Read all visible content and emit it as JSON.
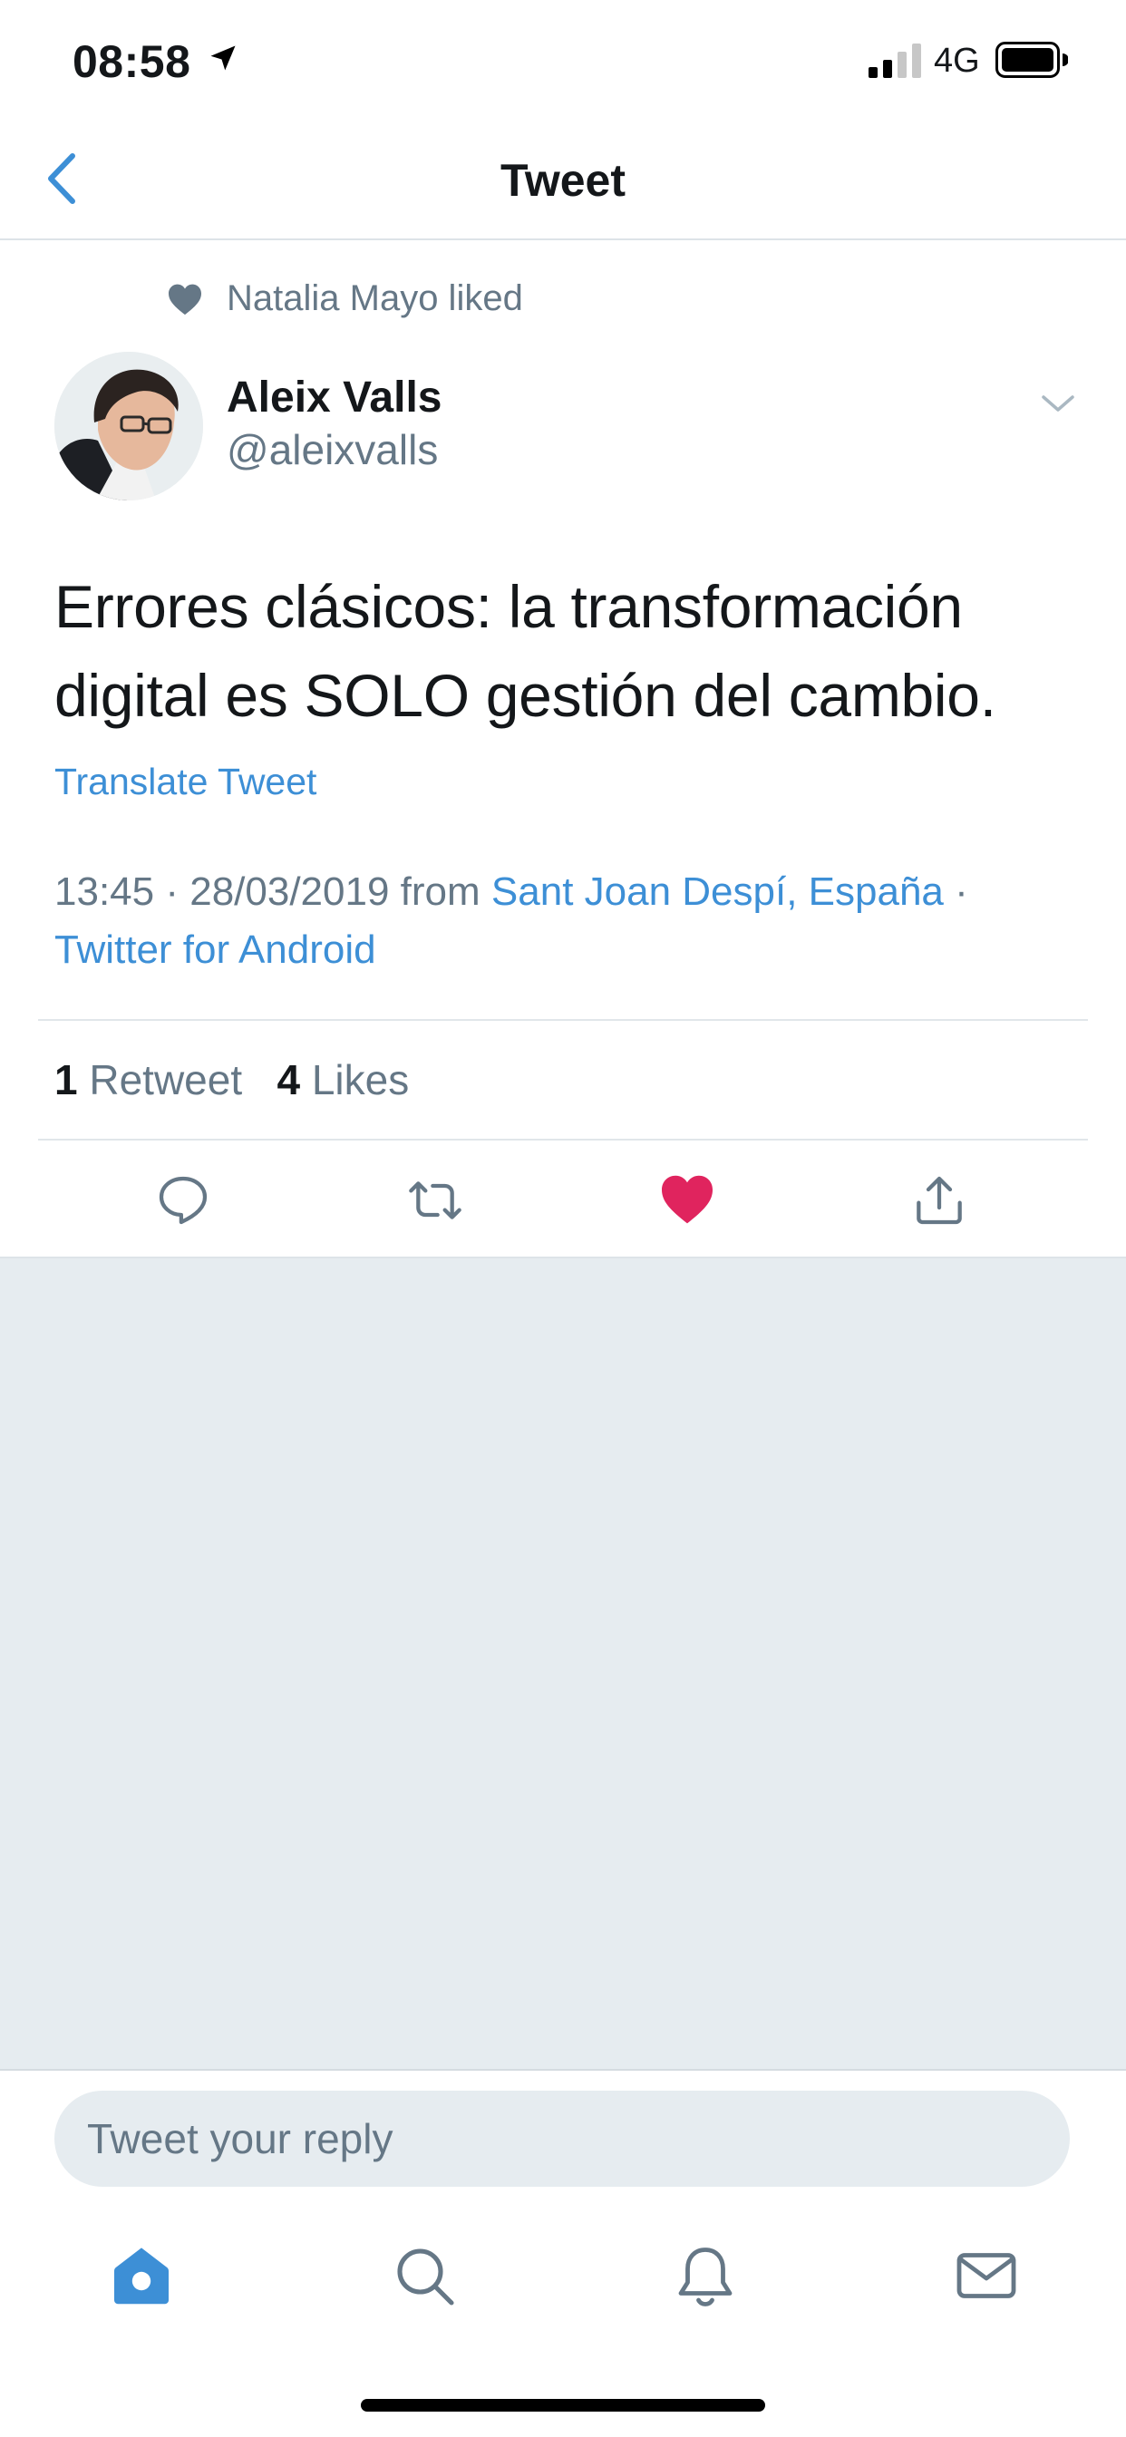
{
  "status_bar": {
    "time": "08:58",
    "network": "4G"
  },
  "nav": {
    "title": "Tweet"
  },
  "social_context": {
    "text": "Natalia Mayo liked"
  },
  "author": {
    "name": "Aleix Valls",
    "handle": "@aleixvalls"
  },
  "tweet": {
    "text": "Errores clásicos: la transformación digital es SOLO gestión del cambio.",
    "translate_label": "Translate Tweet",
    "time": "13:45",
    "date": "28/03/2019",
    "from_label": "from",
    "location": "Sant Joan Despí, España",
    "client": "Twitter for Android"
  },
  "stats": {
    "retweets_count": "1",
    "retweets_label": "Retweet",
    "likes_count": "4",
    "likes_label": "Likes"
  },
  "reply": {
    "placeholder": "Tweet your reply"
  },
  "colors": {
    "accent": "#3d8fd6",
    "like": "#e0245e",
    "secondary_text": "#657786",
    "empty_background": "#e6ecf0"
  },
  "icons": {
    "actions": [
      "reply-icon",
      "retweet-icon",
      "like-icon",
      "share-icon"
    ],
    "tabs": [
      "home-icon",
      "search-icon",
      "notifications-icon",
      "messages-icon"
    ]
  }
}
